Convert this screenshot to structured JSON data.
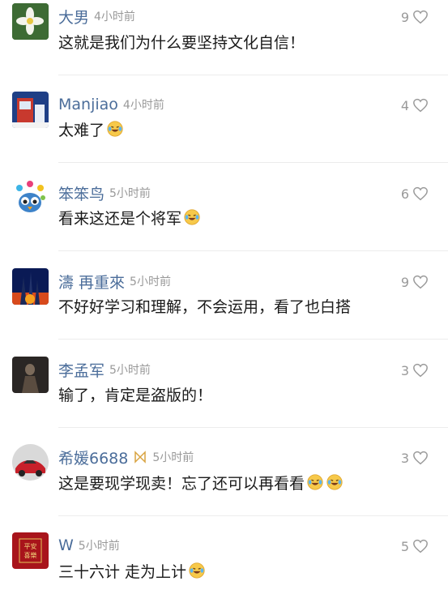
{
  "comments": [
    {
      "user": "大男",
      "time": "4小时前",
      "text": "这就是我们为什么要坚持文化自信！",
      "likes": "9",
      "emoji_count": 0,
      "badge": ""
    },
    {
      "user": "Manjiao",
      "time": "4小时前",
      "text": "太难了",
      "likes": "4",
      "emoji_count": 1,
      "badge": ""
    },
    {
      "user": "笨笨鸟",
      "time": "5小时前",
      "text": "看来这还是个将军",
      "likes": "6",
      "emoji_count": 1,
      "badge": ""
    },
    {
      "user": "濤  再重來",
      "time": "5小时前",
      "text": "不好好学习和理解，不会运用，看了也白搭",
      "likes": "9",
      "emoji_count": 0,
      "badge": ""
    },
    {
      "user": "李孟军",
      "time": "5小时前",
      "text": "输了，肯定是盗版的！",
      "likes": "3",
      "emoji_count": 0,
      "badge": ""
    },
    {
      "user": "希媛6688",
      "time": "5小时前",
      "text": "这是要现学现卖！忘了还可以再看看",
      "likes": "3",
      "emoji_count": 2,
      "badge": "🎀"
    },
    {
      "user": "W",
      "time": "5小时前",
      "text": "三十六计 走为上计",
      "likes": "5",
      "emoji_count": 1,
      "badge": ""
    }
  ],
  "avatar7_text": "平安喜樂",
  "colors": {
    "username": "#4b6d9a",
    "meta": "#999999",
    "text": "#1a1a1a"
  },
  "icons": {
    "like": "heart-outline-icon",
    "emoji": "laughing-crying-emoji-icon"
  }
}
